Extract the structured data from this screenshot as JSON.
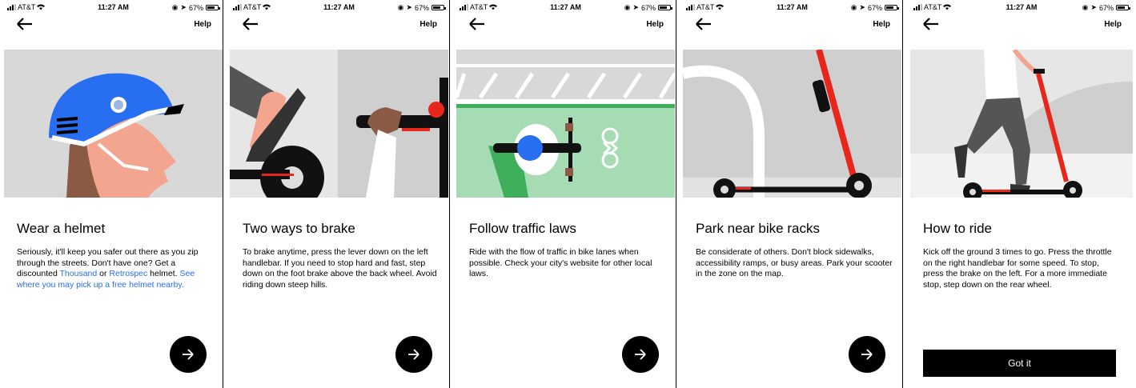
{
  "status_bar": {
    "carrier": "AT&T",
    "time": "11:27 AM",
    "battery": "67%",
    "battery_level": 0.67
  },
  "nav": {
    "help_label": "Help"
  },
  "screens": [
    {
      "title": "Wear a helmet",
      "body_intro": "Seriously, it'll keep you safer out there as you zip through the streets. Don't have one? Get a discounted ",
      "link_thousand": "Thousand",
      "body_or": " or ",
      "link_retrospec": "Retrospec",
      "body_after": " helmet. ",
      "link_pickup": "See where you may pick up a free helmet nearby."
    },
    {
      "title": "Two ways to brake",
      "body": "To brake anytime, press the lever down on the left handlebar. If you need to stop hard and fast, step down on the foot brake above the back wheel. Avoid riding down steep hills."
    },
    {
      "title": "Follow traffic laws",
      "body": "Ride with the flow of traffic in bike lanes when possible. Check your city's website for other local laws."
    },
    {
      "title": "Park near bike racks",
      "body": "Be considerate of others. Don't block sidewalks, accessibility ramps, or busy areas. Park your scooter in the zone on the map."
    },
    {
      "title": "How to ride",
      "body": "Kick off the ground 3 times to go. Press the throttle on the right handlebar for some speed. To stop, press the brake on the left. For a more immediate stop, step down on the rear wheel.",
      "got_it_label": "Got it"
    }
  ],
  "colors": {
    "accent_blue": "#276ef1",
    "scooter_red": "#e8271c",
    "bike_lane_green": "#a6dcb3"
  }
}
